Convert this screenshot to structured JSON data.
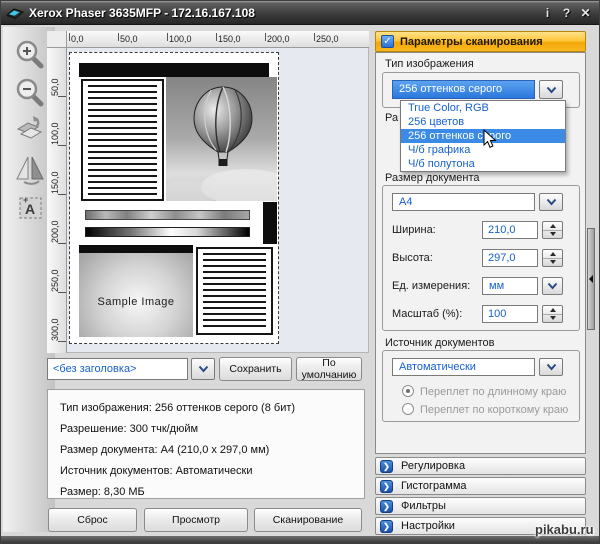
{
  "window": {
    "title": "Xerox Phaser 3635MFP - 172.16.167.108",
    "info_button": "i",
    "help_button": "?",
    "close_button": "✕"
  },
  "toolbar": {
    "items": [
      "zoom-in",
      "zoom-out",
      "rotate-page",
      "mirror-page",
      "auto-detect-text"
    ]
  },
  "rulers": {
    "horizontal": [
      "0,0",
      "50,0",
      "100,0",
      "150,0",
      "200,0",
      "250,0"
    ],
    "vertical": [
      "50,0",
      "100,0",
      "150,0",
      "200,0",
      "250,0",
      "300,0"
    ]
  },
  "preview": {
    "sample_image_caption": "Sample Image"
  },
  "profile_bar": {
    "profile_value": "<без заголовка>",
    "save_button": "Сохранить",
    "default_button": "По умолчанию"
  },
  "info_box": {
    "lines": [
      "Тип изображения: 256 оттенков серого (8 бит)",
      "Разрешение: 300 тчк/дюйм",
      "Размер документа: A4 (210,0 x 297,0 мм)",
      "Источник документов: Автоматически",
      "Размер: 8,30 МБ"
    ]
  },
  "actions": {
    "reset": "Сброс",
    "preview": "Просмотр",
    "scan": "Сканирование"
  },
  "panel": {
    "header": "Параметры сканирования",
    "header_check": "✓",
    "image_type": {
      "label": "Тип изображения",
      "value": "256 оттенков серого",
      "options": [
        "True Color, RGB",
        "256 цветов",
        "256 оттенков серого",
        "Ч/б графика",
        "Ч/б полутона"
      ]
    },
    "clipped_resolution_label": "Ра",
    "document_size": {
      "label": "Размер документа",
      "preset": "A4",
      "width_label": "Ширина:",
      "width_value": "210,0",
      "height_label": "Высота:",
      "height_value": "297,0",
      "units_label": "Ед. измерения:",
      "units_value": "мм",
      "scale_label": "Масштаб (%):",
      "scale_value": "100"
    },
    "document_source": {
      "label": "Источник документов",
      "value": "Автоматически",
      "radio_long": "Переплет по длинному краю",
      "radio_short": "Переплет по короткому краю"
    },
    "accordions": [
      "Регулировка",
      "Гистограмма",
      "Фильтры",
      "Настройки"
    ],
    "accordion_chevron": "❯"
  },
  "watermark": "pikabu.ru",
  "colors": {
    "header_orange": "#F7AE0B",
    "selection_blue": "#3B8AE6",
    "field_text_blue": "#1660D0",
    "titlebar_dark": "#3F3F3F"
  }
}
